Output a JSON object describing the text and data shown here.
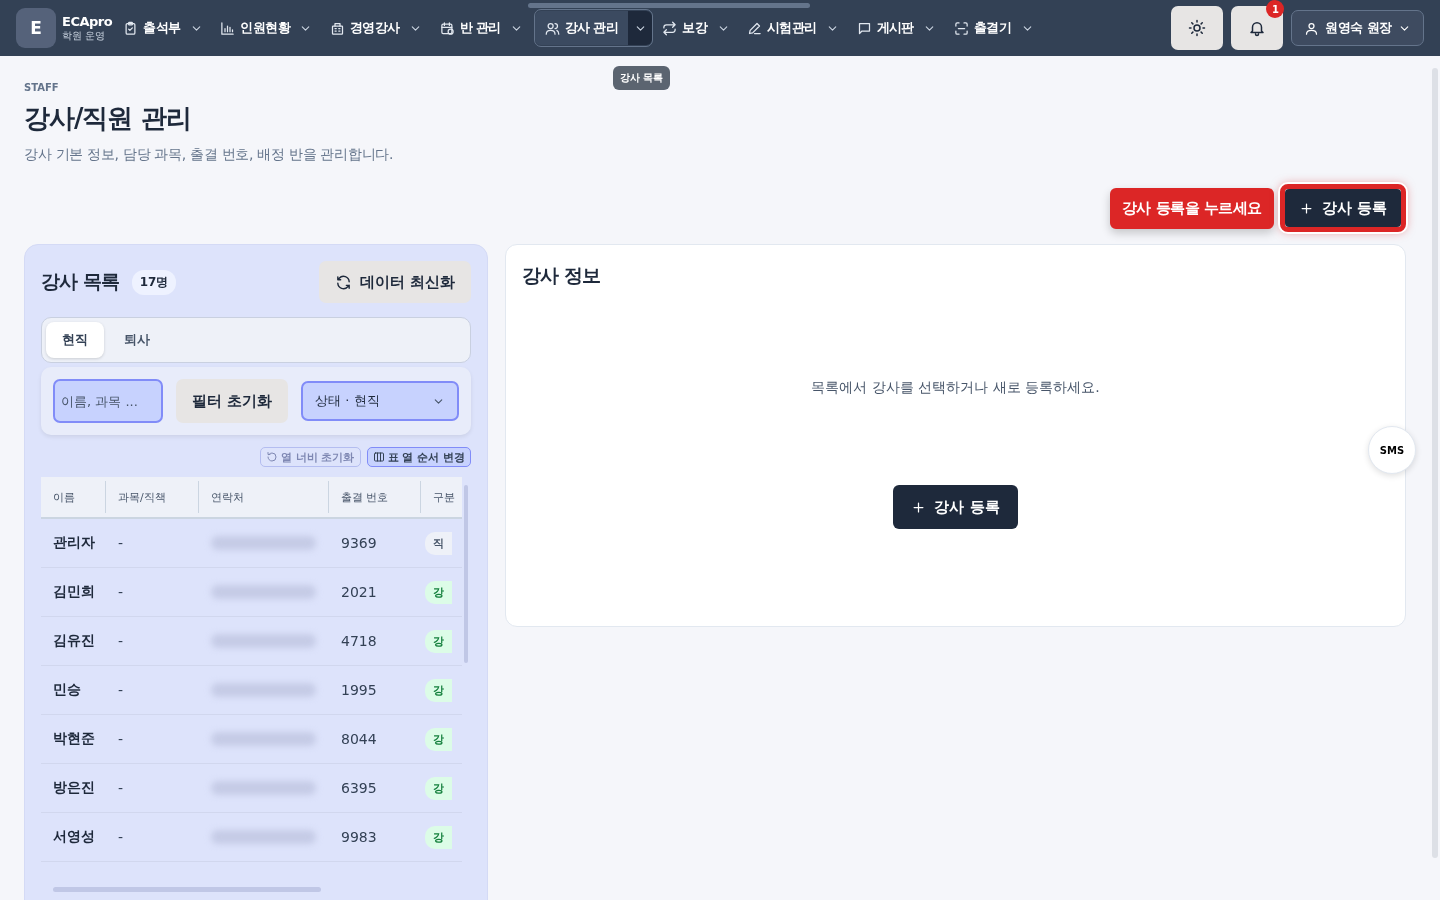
{
  "brand": {
    "logo": "E",
    "name": "ECApro",
    "subtitle": "학원 운영"
  },
  "nav": [
    {
      "label": "출석부",
      "kind": "clipboard",
      "selected": false
    },
    {
      "label": "인원현황",
      "kind": "chart",
      "selected": false
    },
    {
      "label": "경영강사",
      "kind": "building",
      "selected": false
    },
    {
      "label": "반 관리",
      "kind": "calendar",
      "selected": false
    },
    {
      "label": "강사 관리",
      "kind": "users",
      "selected": true
    },
    {
      "label": "보강",
      "kind": "repeat",
      "selected": false
    },
    {
      "label": "시험관리",
      "kind": "pen",
      "selected": false
    },
    {
      "label": "게시판",
      "kind": "message",
      "selected": false
    },
    {
      "label": "출결기",
      "kind": "scan",
      "selected": false
    }
  ],
  "nav_tooltip": "강사 목록",
  "notification_count": "1",
  "user": "원영숙 원장",
  "page": {
    "eyebrow": "STAFF",
    "title": "강사/직원 관리",
    "description": "강사 기본 정보, 담당 과목, 출결 번호, 배정 반을 관리합니다."
  },
  "hint": "강사 등록을 누르세요",
  "register_button": "강사 등록",
  "list": {
    "title": "강사 목록",
    "count": "17명",
    "refresh": "데이터 최신화",
    "tabs": [
      {
        "label": "현직",
        "selected": true
      },
      {
        "label": "퇴사",
        "selected": false
      }
    ],
    "search": {
      "placeholder": "이름, 과목 ..."
    },
    "reset_filter": "필터 초기화",
    "status_filter": "상태 · 현직",
    "reset_widths": {
      "label": "열 너비 초기화",
      "disabled": true
    },
    "reorder_columns": "표 열 순서 변경",
    "columns": [
      "이름",
      "과목/직책",
      "연락처",
      "출결 번호",
      "구분"
    ],
    "rows": [
      {
        "name": "관리자",
        "subject": "-",
        "code": "9369",
        "type": "직",
        "kind": "staff"
      },
      {
        "name": "김민희",
        "subject": "-",
        "code": "2021",
        "type": "강",
        "kind": "teacher"
      },
      {
        "name": "김유진",
        "subject": "-",
        "code": "4718",
        "type": "강",
        "kind": "teacher"
      },
      {
        "name": "민승",
        "subject": "-",
        "code": "1995",
        "type": "강",
        "kind": "teacher"
      },
      {
        "name": "박현준",
        "subject": "-",
        "code": "8044",
        "type": "강",
        "kind": "teacher"
      },
      {
        "name": "방은진",
        "subject": "-",
        "code": "6395",
        "type": "강",
        "kind": "teacher"
      },
      {
        "name": "서영성",
        "subject": "-",
        "code": "9983",
        "type": "강",
        "kind": "teacher"
      }
    ]
  },
  "detail": {
    "title": "강사 정보",
    "empty": "목록에서 강사를 선택하거나 새로 등록하세요.",
    "button": "강사 등록"
  },
  "sms": "SMS"
}
